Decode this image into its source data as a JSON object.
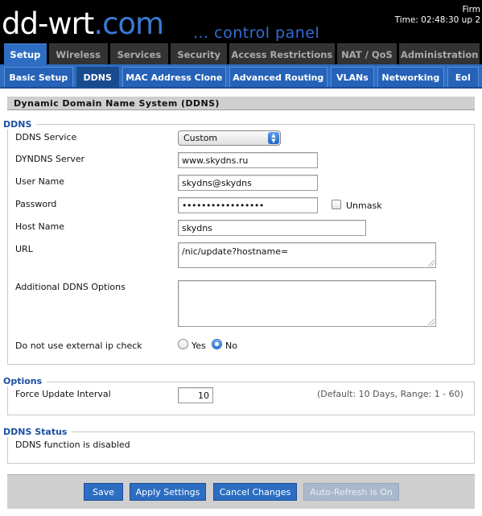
{
  "header": {
    "logo_main": "dd-wrt",
    "logo_dotcom": ".com",
    "tagline": "... control panel",
    "firmware_text": "Firm",
    "time_text": "Time: 02:48:30 up 2"
  },
  "main_tabs": [
    "Setup",
    "Wireless",
    "Services",
    "Security",
    "Access Restrictions",
    "NAT / QoS",
    "Administration"
  ],
  "sub_tabs": [
    "Basic Setup",
    "DDNS",
    "MAC Address Clone",
    "Advanced Routing",
    "VLANs",
    "Networking",
    "EoI"
  ],
  "page_title": "Dynamic Domain Name System (DDNS)",
  "ddns": {
    "legend": "DDNS",
    "service_label": "DDNS Service",
    "service_value": "Custom",
    "server_label": "DYNDNS Server",
    "server_value": "www.skydns.ru",
    "username_label": "User Name",
    "username_value": "skydns@skydns",
    "password_label": "Password",
    "password_value": "•••••••••••••••••",
    "unmask_label": "Unmask",
    "hostname_label": "Host Name",
    "hostname_value": "skydns",
    "url_label": "URL",
    "url_value": "/nic/update?hostname=",
    "options_label": "Additional DDNS Options",
    "options_value": "",
    "ipcheck_label": "Do not use external ip check",
    "yes_label": "Yes",
    "no_label": "No",
    "ipcheck_selected": "No"
  },
  "options": {
    "legend": "Options",
    "force_label": "Force Update Interval",
    "force_value": "10",
    "force_hint": "(Default: 10 Days, Range: 1 - 60)"
  },
  "status": {
    "legend": "DDNS Status",
    "text": "DDNS function is disabled"
  },
  "buttons": {
    "save": "Save",
    "apply": "Apply Settings",
    "cancel": "Cancel Changes",
    "autorefresh": "Auto-Refresh is On"
  },
  "colors": {
    "accent": "#2d6ec2",
    "legend": "#1b4fa0"
  }
}
